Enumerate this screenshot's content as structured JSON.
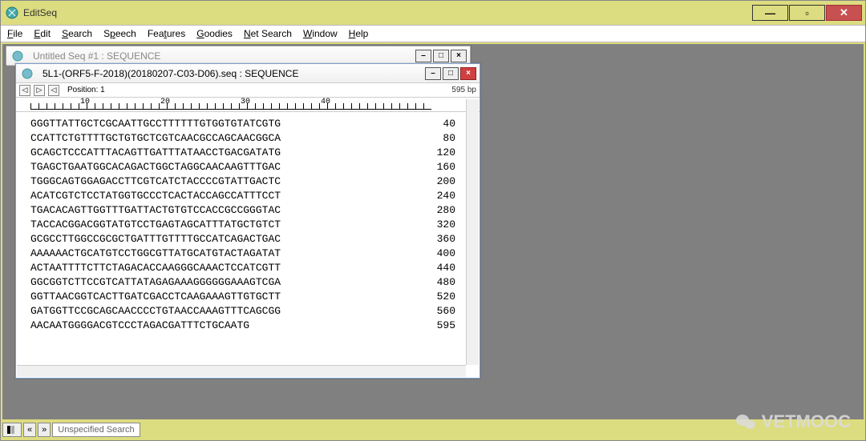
{
  "app": {
    "title": "EditSeq"
  },
  "menu": {
    "file": "File",
    "edit": "Edit",
    "search": "Search",
    "speech": "Speech",
    "features": "Features",
    "goodies": "Goodies",
    "netsearch": "Net Search",
    "window": "Window",
    "help": "Help"
  },
  "win_controls": {
    "min": "—",
    "max": "▫",
    "close": "✕"
  },
  "bg_window": {
    "title": "Untitled Seq #1 : SEQUENCE"
  },
  "seq_window": {
    "title": "5L1-(ORF5-F-2018)(20180207-C03-D06).seq : SEQUENCE",
    "position_label": "Position: 1",
    "length_label": "595 bp",
    "ruler_marks": [
      "10",
      "20",
      "30",
      "40"
    ],
    "rows": [
      {
        "seq": "GGGTTATTGCTCGCAATTGCCTTTTTTGTGGTGTATCGTG",
        "end": "40"
      },
      {
        "seq": "CCATTCTGTTTTGCTGTGCTCGTCAACGCCAGCAACGGCA",
        "end": "80"
      },
      {
        "seq": "GCAGCTCCCATTTACAGTTGATTTATAACCTGACGATATG",
        "end": "120"
      },
      {
        "seq": "TGAGCTGAATGGCACAGACTGGCTAGGCAACAAGTTTGAC",
        "end": "160"
      },
      {
        "seq": "TGGGCAGTGGAGACCTTCGTCATCTACCCCGTATTGACTC",
        "end": "200"
      },
      {
        "seq": "ACATCGTCTCCTATGGTGCCCTCACTACCAGCCATTTCCT",
        "end": "240"
      },
      {
        "seq": "TGACACAGTTGGTTTGATTACTGTGTCCACCGCCGGGTAC",
        "end": "280"
      },
      {
        "seq": "TACCACGGACGGTATGTCCTGAGTAGCATTTATGCTGTCT",
        "end": "320"
      },
      {
        "seq": "GCGCCTTGGCCGCGCTGATTTGTTTTGCCATCAGACTGAC",
        "end": "360"
      },
      {
        "seq": "AAAAAACTGCATGTCCTGGCGTTATGCATGTACTAGATAT",
        "end": "400"
      },
      {
        "seq": "ACTAATTTTCTTCTAGACACCAAGGGCAAACTCCATCGTT",
        "end": "440"
      },
      {
        "seq": "GGCGGTCTTCCGTCATTATAGAGAAAGGGGGGAAAGTCGA",
        "end": "480"
      },
      {
        "seq": "GGTTAACGGTCACTTGATCGACCTCAAGAAAGTTGTGCTT",
        "end": "520"
      },
      {
        "seq": "GATGGTTCCGCAGCAACCCCTGTAACCAAAGTTTCAGCGG",
        "end": "560"
      },
      {
        "seq": "AACAATGGGGACGTCCCTAGACGATTTCTGCAATG",
        "end": "595"
      }
    ]
  },
  "statusbar": {
    "search_label": "Unspecified Search"
  },
  "watermark": {
    "text": "VETMOOC"
  },
  "chart_data": {
    "type": "table",
    "title": "DNA sequence 5L1-(ORF5-F-2018)(20180207-C03-D06).seq, 595 bp",
    "columns": [
      "bases_40_per_line",
      "end_position"
    ],
    "rows": [
      [
        "GGGTTATTGCTCGCAATTGCCTTTTTTGTGGTGTATCGTG",
        40
      ],
      [
        "CCATTCTGTTTTGCTGTGCTCGTCAACGCCAGCAACGGCA",
        80
      ],
      [
        "GCAGCTCCCATTTACAGTTGATTTATAACCTGACGATATG",
        120
      ],
      [
        "TGAGCTGAATGGCACAGACTGGCTAGGCAACAAGTTTGAC",
        160
      ],
      [
        "TGGGCAGTGGAGACCTTCGTCATCTACCCCGTATTGACTC",
        200
      ],
      [
        "ACATCGTCTCCTATGGTGCCCTCACTACCAGCCATTTCCT",
        240
      ],
      [
        "TGACACAGTTGGTTTGATTACTGTGTCCACCGCCGGGTAC",
        280
      ],
      [
        "TACCACGGACGGTATGTCCTGAGTAGCATTTATGCTGTCT",
        320
      ],
      [
        "GCGCCTTGGCCGCGCTGATTTGTTTTGCCATCAGACTGAC",
        360
      ],
      [
        "AAAAAACTGCATGTCCTGGCGTTATGCATGTACTAGATAT",
        400
      ],
      [
        "ACTAATTTTCTTCTAGACACCAAGGGCAAACTCCATCGTT",
        440
      ],
      [
        "GGCGGTCTTCCGTCATTATAGAGAAAGGGGGGAAAGTCGA",
        480
      ],
      [
        "GGTTAACGGTCACTTGATCGACCTCAAGAAAGTTGTGCTT",
        520
      ],
      [
        "GATGGTTCCGCAGCAACCCCTGTAACCAAAGTTTCAGCGG",
        560
      ],
      [
        "AACAATGGGGACGTCCCTAGACGATTTCTGCAATG",
        595
      ]
    ]
  }
}
